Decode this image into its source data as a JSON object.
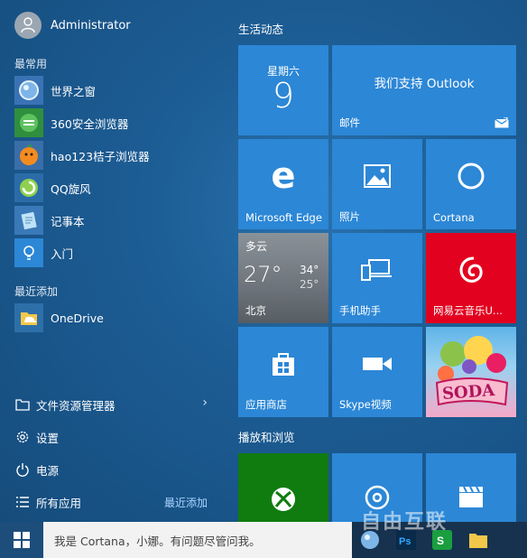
{
  "user": {
    "name": "Administrator"
  },
  "sections": {
    "most_used": "最常用",
    "recently_added": "最近添加"
  },
  "most_used_apps": [
    {
      "label": "世界之窗",
      "icon": "globe-icon"
    },
    {
      "label": "360安全浏览器",
      "icon": "360-browser-icon"
    },
    {
      "label": "hao123桔子浏览器",
      "icon": "orange-browser-icon"
    },
    {
      "label": "QQ旋风",
      "icon": "qq-whirlwind-icon"
    },
    {
      "label": "记事本",
      "icon": "notepad-icon"
    },
    {
      "label": "入门",
      "icon": "lightbulb-icon"
    }
  ],
  "recent_apps": [
    {
      "label": "OneDrive",
      "icon": "onedrive-icon"
    }
  ],
  "bottom_menu": {
    "explorer": "文件资源管理器",
    "settings": "设置",
    "power": "电源",
    "all_apps": "所有应用",
    "recently_added_link": "最近添加"
  },
  "groups": {
    "live": "生活动态",
    "play": "播放和浏览"
  },
  "tiles": {
    "calendar": {
      "weekday": "星期六",
      "day": "9"
    },
    "mail": {
      "headline": "我们支持 Outlook",
      "label": "邮件"
    },
    "edge": {
      "label": "Microsoft Edge"
    },
    "photos": {
      "label": "照片"
    },
    "cortana": {
      "label": "Cortana"
    },
    "weather": {
      "condition": "多云",
      "temp": "27°",
      "high": "34°",
      "low": "25°",
      "city": "北京"
    },
    "phone": {
      "label": "手机助手"
    },
    "netease": {
      "label": "网易云音乐U..."
    },
    "store": {
      "label": "应用商店"
    },
    "skype": {
      "label": "Skype视频"
    },
    "candy": {
      "label": "SODA"
    }
  },
  "taskbar": {
    "search_placeholder": "我是 Cortana，小娜。有问题尽管问我。"
  },
  "watermark": "自由互联",
  "colors": {
    "tile_blue": "#2c87d6",
    "xbox_green": "#107c10",
    "netease_red": "#e2021f"
  }
}
